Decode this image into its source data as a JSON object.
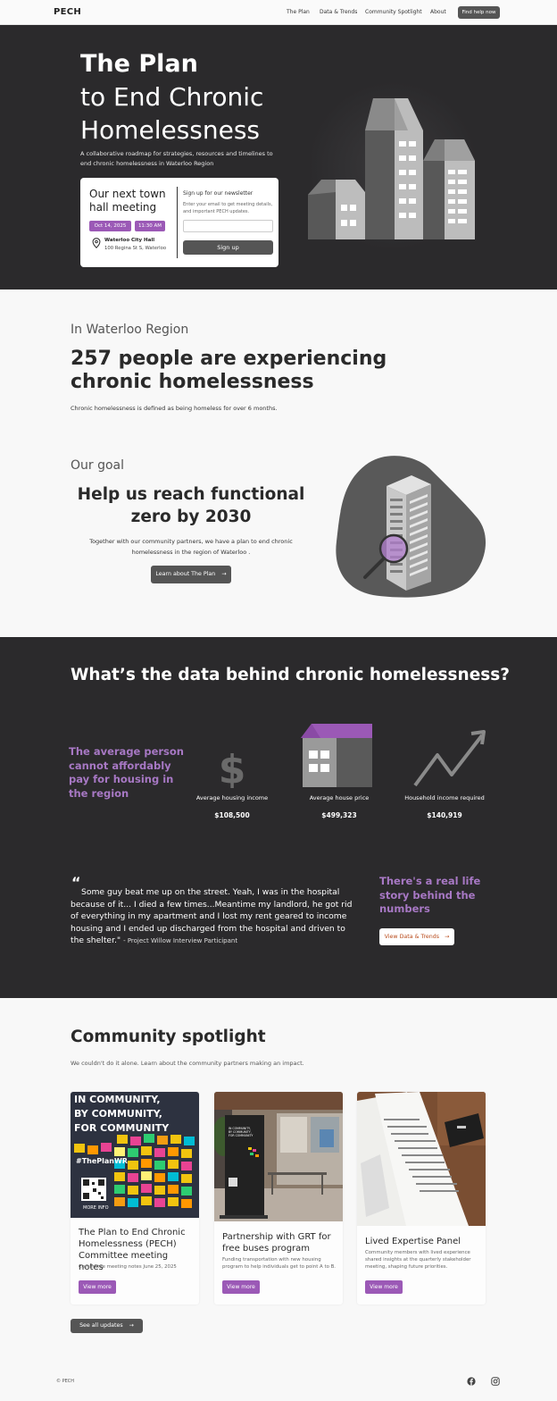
{
  "nav": {
    "logo": "PECH",
    "links": [
      "The Plan",
      "Data & Trends",
      "Community Spotlight",
      "About"
    ],
    "cta": "Find help now"
  },
  "hero": {
    "title_line1": "The Plan",
    "title_line2": "to End Chronic",
    "title_line3": "Homelessness",
    "subtitle": "A collaborative roadmap for strategies, resources and timelines to end chronic homelessness in Waterloo Region",
    "meeting": {
      "title": "Our next town hall meeting",
      "date": "Oct 14, 2025",
      "time": "11:30 AM",
      "location_name": "Waterloo City Hall",
      "location_address": "100 Regina St S, Waterloo"
    },
    "newsletter": {
      "title": "Sign up for our newsletter",
      "description": "Enter your email to get meeting details, and important PECH updates.",
      "input_placeholder": "",
      "button": "Sign up"
    }
  },
  "stats": {
    "kicker": "In Waterloo Region",
    "headline": "257 people are experiencing chronic homelessness",
    "definition": "Chronic homelessness is defined as being homeless for over 6 months."
  },
  "goal": {
    "kicker": "Our goal",
    "title": "Help us reach functional zero by 2030",
    "description": "Together with our community partners, we have a plan to end chronic homelessness in the region of Waterloo .",
    "button": "Learn about The Plan"
  },
  "data_section": {
    "title": "What’s the data behind chronic homelessness?",
    "callout": "The average person cannot affordably pay for housing in the region",
    "items": [
      {
        "label": "Average housing income",
        "value": "$108,500",
        "icon": "dollar-icon"
      },
      {
        "label": "Average house price",
        "value": "$499,323",
        "icon": "house-icon"
      },
      {
        "label": "Household income required",
        "value": "$140,919",
        "icon": "trend-arrow-icon"
      }
    ],
    "quote_mark": "“",
    "quote": "Some guy beat me up on the street. Yeah, I was in the hospital because of it... I died a few times...Meantime my landlord, he got rid of everything in my apartment and I lost my rent geared to income housing and I ended up discharged from the hospital and driven to the shelter.\"",
    "attribution": "- Project Willow Interview Participant",
    "story_callout": "There's a real life story behind the numbers",
    "story_button": "View Data & Trends"
  },
  "spotlight": {
    "title": "Community spotlight",
    "subtitle": "We couldn't do it alone. Learn about the community partners making an impact.",
    "cards": [
      {
        "image_text_1": "IN COMMUNITY,",
        "image_text_2": "BY COMMUNITY,",
        "image_text_3": "FOR COMMUNITY",
        "image_hashtag": "#ThePlanWR",
        "image_more": "MORE INFO",
        "title": "The Plan to End Chronic Homelessness (PECH) Committee meeting notes",
        "description": "Committee meeting notes June 25, 2025",
        "button": "View more"
      },
      {
        "image_text": "IN COMMUNITY, BY COMMUNITY, FOR COMMUNITY",
        "title": "Partnership with GRT for free buses program",
        "description": "Funding transportation with new housing program to help individuals get to point A to B.",
        "button": "View more"
      },
      {
        "title": "Lived Expertise Panel",
        "description": "Community members with lived experience shared insights at the quarterly stakeholder meeting, shaping future priorities.",
        "button": "View more"
      }
    ],
    "all_button": "See all updates"
  },
  "footer": {
    "copyright": "© PECH",
    "social": [
      "facebook-icon",
      "instagram-icon"
    ]
  },
  "colors": {
    "accent": "#9b59b6",
    "accent_text": "#a778c4",
    "dark_bg": "#2b2a2c",
    "light_bg": "#f8f8f8"
  }
}
